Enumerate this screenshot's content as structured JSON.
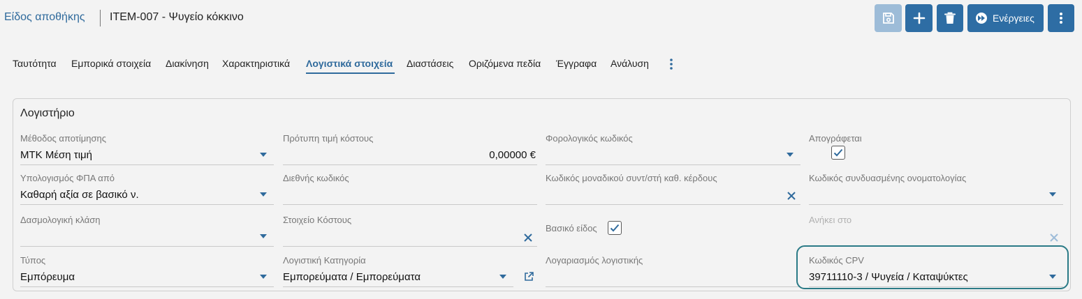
{
  "breadcrumb": {
    "parent": "Είδος αποθήκης",
    "title": "ITEM-007 - Ψυγείο κόκκινο"
  },
  "toolbar": {
    "actions_label": "Ενέργειες"
  },
  "tabs": [
    "Ταυτότητα",
    "Εμπορικά στοιχεία",
    "Διακίνηση",
    "Χαρακτηριστικά",
    "Λογιστικά στοιχεία",
    "Διαστάσεις",
    "Οριζόμενα πεδία",
    "Έγγραφα",
    "Ανάλυση"
  ],
  "active_tab": "Λογιστικά στοιχεία",
  "panel": {
    "title": "Λογιστήριο",
    "fields": {
      "valuation_method": {
        "label": "Μέθοδος αποτίμησης",
        "value": "ΜΤΚ Μέση τιμή"
      },
      "standard_cost": {
        "label": "Πρότυπη τιμή κόστους",
        "value": "0,00000 €"
      },
      "tax_code": {
        "label": "Φορολογικός κωδικός",
        "value": ""
      },
      "inventoried": {
        "label": "Απογράφεται",
        "checked": true
      },
      "vat_from": {
        "label": "Υπολογισμός ΦΠΑ από",
        "value": "Καθαρή αξία σε βασικό ν."
      },
      "intl_code": {
        "label": "Διεθνής κωδικός",
        "value": ""
      },
      "unique_profit_code": {
        "label": "Κωδικός μοναδικού συντ/στή καθ. κέρδους",
        "value": ""
      },
      "combined_nomenclature": {
        "label": "Κωδικός συνδυασμένης ονοματολογίας",
        "value": ""
      },
      "customs_class": {
        "label": "Δασμολογική κλάση",
        "value": ""
      },
      "cost_element": {
        "label": "Στοιχείο Κόστους",
        "value": ""
      },
      "base_item": {
        "label": "Βασικό είδος",
        "checked": true
      },
      "belongs_to": {
        "label": "Ανήκει στο",
        "value": ""
      },
      "type": {
        "label": "Τύπος",
        "value": "Εμπόρευμα"
      },
      "accounting_category": {
        "label": "Λογιστική Κατηγορία",
        "value": "Εμπορεύματα / Εμπορεύματα"
      },
      "accounting_account": {
        "label": "Λογαριασμός λογιστικής",
        "value": ""
      },
      "cpv_code": {
        "label": "Κωδικός CPV",
        "value": "39711110-3 / Ψυγεία / Καταψύκτες"
      }
    }
  },
  "colors": {
    "primary": "#2e6da4",
    "primary_disabled": "#9dbcd8",
    "focus": "#2a7a86",
    "link": "#2f6a9c"
  }
}
